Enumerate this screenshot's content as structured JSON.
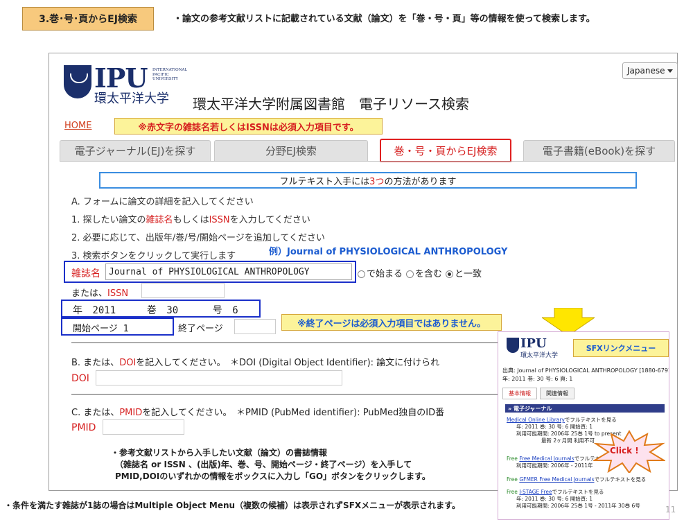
{
  "slide": {
    "tag": "3.巻･号･頁からEJ検索",
    "description": "・論文の参考文献リストに記載されている文献（論文）を「巻・号・頁」等の情報を使って検索します。",
    "footer": "・条件を満たす雑誌が1誌の場合はMultiple Object Menu（複数の候補）は表示されずSFXメニューが表示されます。",
    "page_number": "11",
    "bottom_notes": [
      "・参考文献リストから入手したい文献（論文）の書誌情報",
      "（雑誌名 or  ISSN 、(出版)年、巻、号、開始ページ・終了ページ）を入手して",
      "PMID,DOIのいずれかの情報をボックスに入力し「GO」ボタンをクリックします。"
    ],
    "example_label": "例）Journal of PHYSIOLOGICAL ANTHROPOLOGY",
    "end_page_note": "※終了ページは必須入力項目ではありません。"
  },
  "header": {
    "logo_text": "IPU",
    "logo_small": [
      "INTERNATIONAL",
      "PACIFIC",
      "UNIVERSITY"
    ],
    "logo_kanji": "環太平洋大学",
    "title": "環太平洋大学附属図書館　電子リソース検索",
    "language": "Japanese",
    "home": "HOME",
    "required_note": "※赤文字の雑誌名若しくはISSNは必須入力項目です。"
  },
  "tabs": [
    {
      "label": "電子ジャーナル(EJ)を探す"
    },
    {
      "label": "分野EJ検索"
    },
    {
      "label": "巻・号・頁からEJ検索"
    },
    {
      "label": "電子書籍(eBook)を探す"
    }
  ],
  "form": {
    "info_pre": "フルテキスト入手には",
    "info_num": "3つ",
    "info_post": "の方法があります",
    "stepA": "A. フォームに論文の詳細を記入してください",
    "step1_pre": "1. 探したい論文の",
    "step1_red1": "雑誌名",
    "step1_mid": "もしくは",
    "step1_red2": "ISSN",
    "step1_post": "を入力してください",
    "step2": "2. 必要に応じて、出版年/巻/号/開始ページを追加してください",
    "step3": "3. 検索ボタンをクリックして実行します",
    "journal_label": "雑誌名",
    "journal_value": "Journal of PHYSIOLOGICAL ANTHROPOLOGY",
    "radio1": "で始まる",
    "radio2": "を含む",
    "radio3": "と一致",
    "issn_pre": "または、",
    "issn_red": "ISSN",
    "year_label": "年",
    "year_value": "2011",
    "volume_label": "巻",
    "volume_value": "30",
    "issue_label": "号",
    "issue_value": "6",
    "start_label": "開始ページ",
    "start_value": "1",
    "end_label": "終了ページ",
    "secB_pre": "B. または、",
    "secB_red": "DOI",
    "secB_post": "を記入してください。　＊DOI (Digital Object Identifier): 論文に付けられ",
    "doi_label": "DOI",
    "secC_pre": "C. または、",
    "secC_red": "PMID",
    "secC_post": "を記入してください。　＊PMID (PubMed identifier): PubMed独自のID番",
    "pmid_label": "PMID"
  },
  "sfx": {
    "tag": "SFXリンクメニュー",
    "logo": "IPU",
    "logo_kanji": "環太平洋大学",
    "source_line": "出典: Journal of PHYSIOLOGICAL ANTHROPOLOGY [1880-6791]",
    "source_line2": "年: 2011  巻: 30  号: 6  頁: 1",
    "tab1": "基本情報",
    "tab2": "関連情報",
    "section": "» 電子ジャーナル",
    "items": [
      {
        "free": "",
        "link": "Medical Online Library",
        "post": "でフルテキストを見る",
        "line2": "年: 2011   巻: 30   号: 6   開始頁: 1",
        "line3": "利用可能期間: 2006年 25巻 1号 to present",
        "line4": "最新 2ヶ月間 利用不可"
      },
      {
        "free": "Free ",
        "link": "Free Medical Journals",
        "post": "でフルテキストを見る",
        "line2": "利用可能期間: 2006年 - 2011年"
      },
      {
        "free": "Free ",
        "link": "GFMER Free Medical Journals",
        "post": "でフルテキストを見る"
      },
      {
        "free": "Free ",
        "link": "J-STAGE Free",
        "post": "でフルテキストを見る",
        "line2": "年: 2011   巻: 30   号: 6   開始頁: 1",
        "line3": "利用可能期間: 2006年 25巻 1号 - 2011年 30巻 6号"
      }
    ],
    "go": "GO",
    "click": "Click !"
  }
}
